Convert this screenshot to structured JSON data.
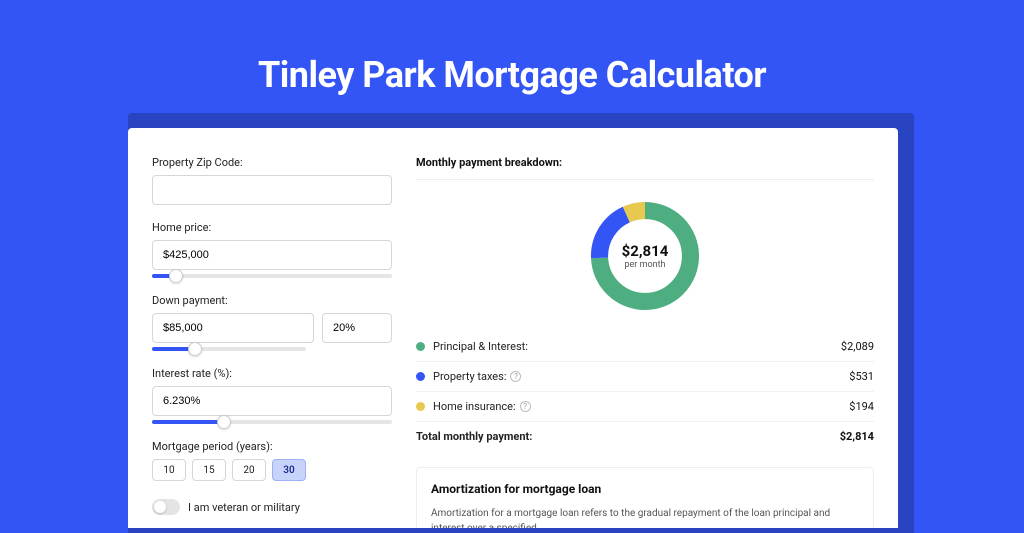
{
  "title": "Tinley Park Mortgage Calculator",
  "form": {
    "zip_label": "Property Zip Code:",
    "zip_value": "",
    "home_price_label": "Home price:",
    "home_price_value": "$425,000",
    "down_payment_label": "Down payment:",
    "down_payment_value": "$85,000",
    "down_payment_pct": "20%",
    "interest_label": "Interest rate (%):",
    "interest_value": "6.230%",
    "period_label": "Mortgage period (years):",
    "period_options": [
      "10",
      "15",
      "20",
      "30"
    ],
    "period_selected": "30",
    "veteran_label": "I am veteran or military"
  },
  "breakdown": {
    "heading": "Monthly payment breakdown:",
    "donut_amount": "$2,814",
    "donut_sub": "per month",
    "rows": [
      {
        "label": "Principal & Interest:",
        "value": "$2,089",
        "color": "green",
        "help": false
      },
      {
        "label": "Property taxes:",
        "value": "$531",
        "color": "blue",
        "help": true
      },
      {
        "label": "Home insurance:",
        "value": "$194",
        "color": "yellow",
        "help": true
      }
    ],
    "total_label": "Total monthly payment:",
    "total_value": "$2,814"
  },
  "amort": {
    "heading": "Amortization for mortgage loan",
    "body": "Amortization for a mortgage loan refers to the gradual repayment of the loan principal and interest over a specified"
  },
  "chart_data": {
    "type": "pie",
    "title": "Monthly payment breakdown",
    "series": [
      {
        "name": "Principal & Interest",
        "value": 2089,
        "color": "#4fae81"
      },
      {
        "name": "Property taxes",
        "value": 531,
        "color": "#3455f5"
      },
      {
        "name": "Home insurance",
        "value": 194,
        "color": "#e7c94f"
      }
    ],
    "total": 2814,
    "total_label": "$2,814 per month"
  }
}
